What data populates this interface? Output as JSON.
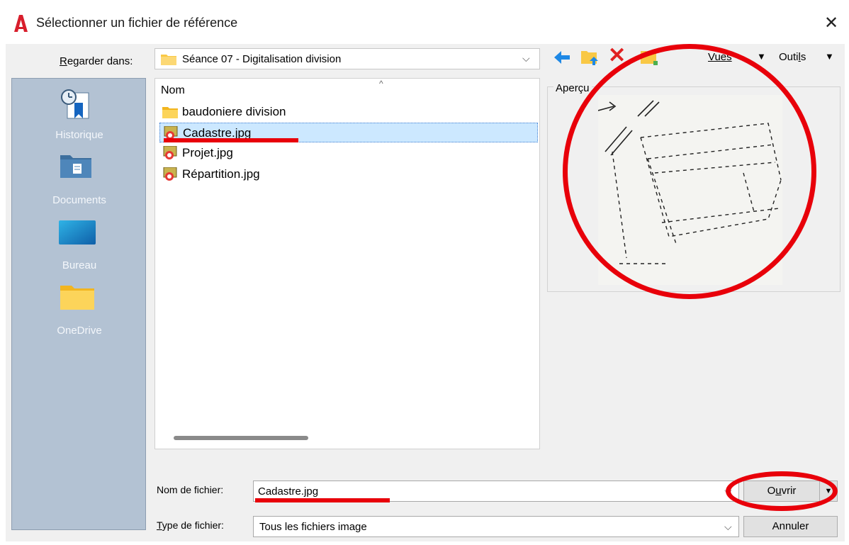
{
  "window": {
    "title": "Sélectionner un fichier de référence",
    "close_glyph": "✕",
    "app_icon": "autocad-logo-icon"
  },
  "lookin": {
    "label_prefix": "R",
    "label_rest": "egarder dans:",
    "value": "Séance 07 - Digitalisation division",
    "chevron": "⌵"
  },
  "toolbar": {
    "back_icon": "back-arrow-icon",
    "up_icon": "up-folder-icon",
    "delete_glyph": "✕",
    "newfolder_icon": "new-folder-icon",
    "views_label": "Vues",
    "tools_prefix": "Outi",
    "tools_mnemonic": "l",
    "tools_suffix": "s",
    "arrow": "▼"
  },
  "places": [
    {
      "label": "Historique",
      "icon": "history-icon"
    },
    {
      "label": "Documents",
      "icon": "documents-icon"
    },
    {
      "label": "Bureau",
      "icon": "desktop-icon"
    },
    {
      "label": "OneDrive",
      "icon": "onedrive-folder-icon"
    }
  ],
  "filelist": {
    "column_name": "Nom",
    "sort_caret": "^",
    "items": [
      {
        "name": "baudoniere division",
        "type": "folder",
        "selected": false
      },
      {
        "name": "Cadastre.jpg",
        "type": "image",
        "selected": true
      },
      {
        "name": "Projet.jpg",
        "type": "image",
        "selected": false
      },
      {
        "name": "Répartition.jpg",
        "type": "image",
        "selected": false
      }
    ]
  },
  "preview": {
    "label": "Aperçu"
  },
  "filename": {
    "label_prefix": "Nom de fichier:",
    "value": "Cadastre.jpg",
    "chevron": "⌵"
  },
  "filetype": {
    "label_prefix": "T",
    "label_rest": "ype de fichier:",
    "value": "Tous les fichiers image",
    "chevron": "⌵"
  },
  "buttons": {
    "open_prefix": "O",
    "open_mnemonic": "u",
    "open_suffix": "vrir",
    "open_split": "▼",
    "cancel": "Annuler"
  },
  "colors": {
    "annotation_red": "#e8000a",
    "sidebar_bg": "#b3c2d3",
    "selection_bg": "#cce8ff"
  }
}
